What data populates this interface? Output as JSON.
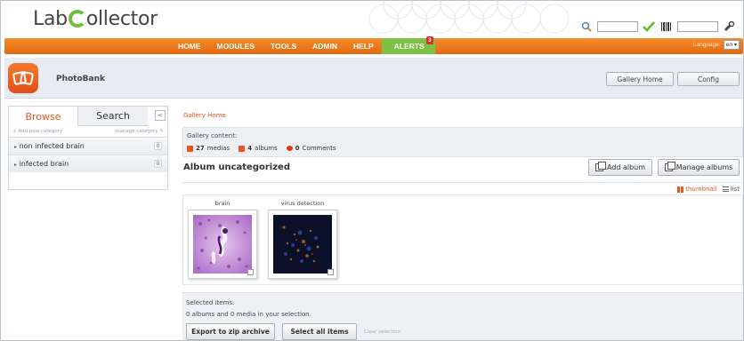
{
  "app": {
    "logo_pre": "Lab",
    "logo_post": "ollector"
  },
  "nav": {
    "items": [
      "HOME",
      "MODULES",
      "TOOLS",
      "ADMIN",
      "HELP"
    ],
    "alerts_label": "ALERTS",
    "alerts_count": "3",
    "language_label": "Language:",
    "language_value": "en"
  },
  "module": {
    "title": "PhotoBank",
    "gallery_home_button": "Gallery Home",
    "config_button": "Config"
  },
  "sidebar": {
    "tab_browse": "Browse",
    "tab_search": "Search",
    "collapse_icon": "<",
    "add_category": "+ Add new category",
    "manage_category": "manage category",
    "categories": [
      {
        "label": "non infected brain",
        "count": "0"
      },
      {
        "label": "infected brain",
        "count": "0"
      }
    ]
  },
  "main": {
    "breadcrumb": "Gallery Home",
    "gallery_content_title": "Gallery content:",
    "stats": {
      "medias_count": "27",
      "medias_label": "medias",
      "albums_count": "4",
      "albums_label": "albums",
      "comments_count": "0",
      "comments_label": "Comments"
    },
    "album_title": "Album uncategorized",
    "add_album_button": "Add album",
    "manage_albums_button": "Manage albums",
    "view_thumbnail": "thumbnail",
    "view_list": "list",
    "thumbnails": [
      {
        "caption": "brain"
      },
      {
        "caption": "virus detection"
      }
    ]
  },
  "selection": {
    "title": "Selected items:",
    "info": "0 albums and 0 media in your selection.",
    "export_button": "Export to zip archive",
    "select_all_button": "Select all items",
    "clear_link": "Clear selection"
  },
  "colors": {
    "accent_orange": "#e8561c",
    "nav_orange": "#f58a28",
    "alert_green": "#7bc142",
    "logo_green": "#6fbf3a"
  }
}
